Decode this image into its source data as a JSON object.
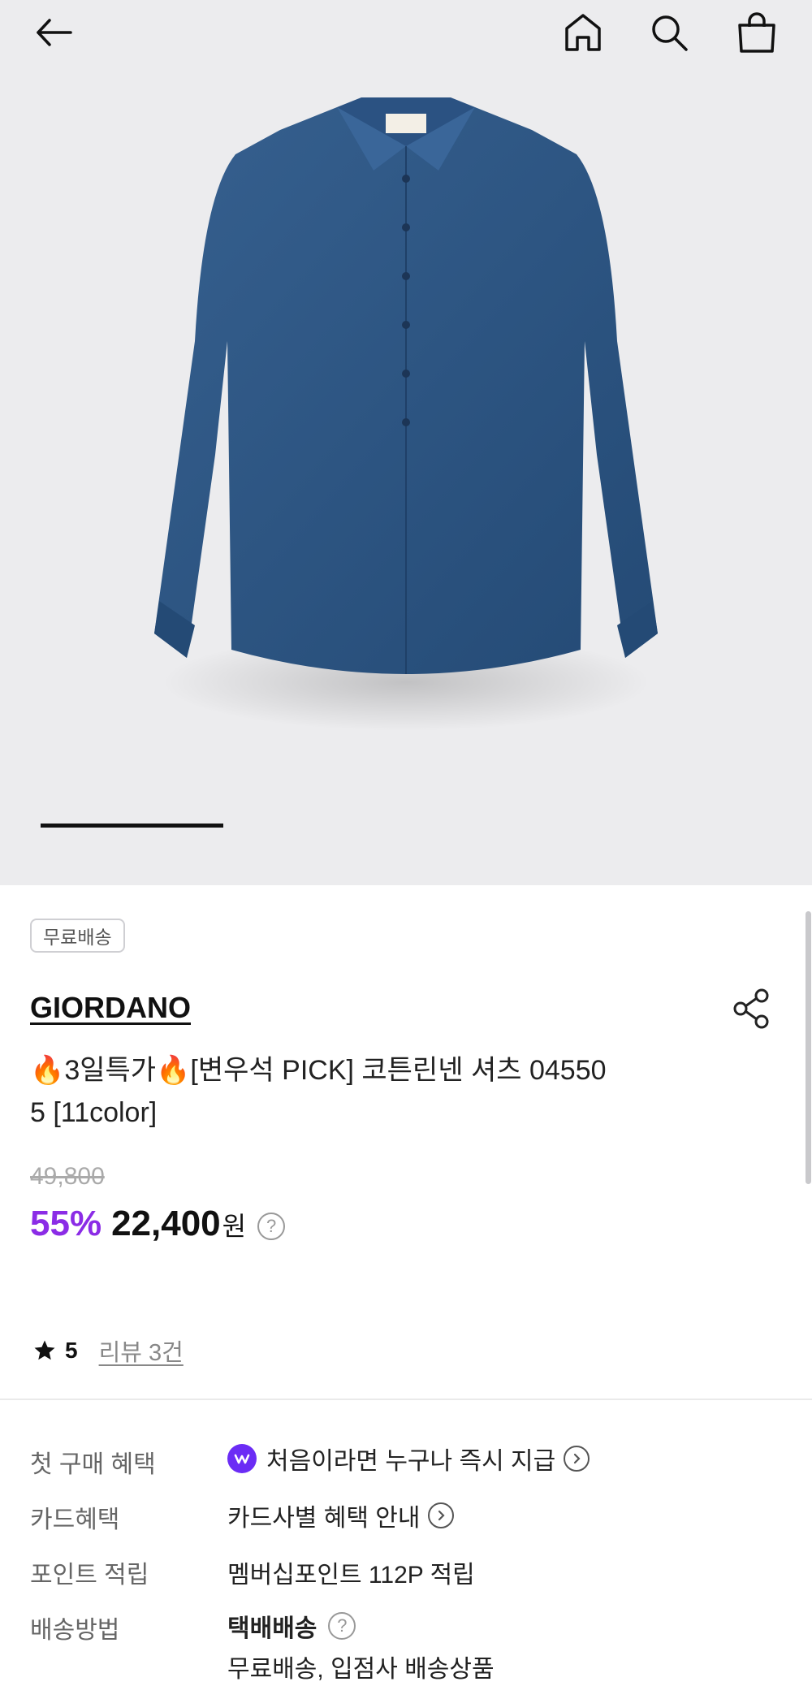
{
  "header": {
    "icons": [
      "back-arrow-icon",
      "home-icon",
      "search-icon",
      "shopping-bag-icon"
    ]
  },
  "gallery": {
    "image_subject": "navy long-sleeve button-down shirt",
    "progress_fraction": 0.25
  },
  "product": {
    "shipping_badge": "무료배송",
    "brand": "GIORDANO",
    "title_line1": "🔥3일특가🔥[변우석 PICK] 코튼린넨 셔츠 04550",
    "title_line2": "5 [11color]",
    "original_price": "49,800",
    "discount_rate": "55%",
    "sale_price": "22,400",
    "currency": "원",
    "rating": "5",
    "review_link": "리뷰 3건"
  },
  "benefits": [
    {
      "label": "첫 구매 혜택",
      "value": "처음이라면 누구나 즉시 지급"
    },
    {
      "label": "카드혜택",
      "value": "카드사별 혜택 안내"
    },
    {
      "label": "포인트 적립",
      "value": "멤버십포인트 112P 적립"
    },
    {
      "label": "배송방법",
      "value": "택배배송",
      "subvalue": "무료배송, 입점사 배송상품"
    }
  ],
  "colors": {
    "hero_bg": "#ececee",
    "discount": "#8b2ce6",
    "shirt": "#2e5684",
    "w_badge": "#6b2cf5"
  }
}
